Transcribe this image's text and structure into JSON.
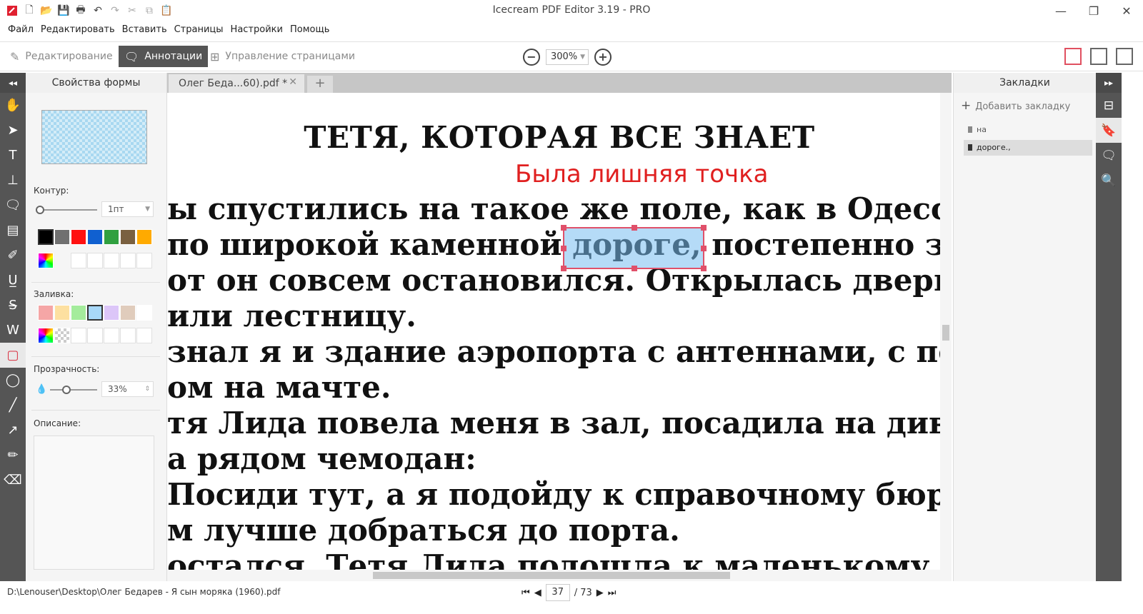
{
  "window": {
    "title": "Icecream PDF Editor 3.19 - PRO",
    "controls": {
      "minimize": "—",
      "maximize": "❐",
      "close": "✕"
    }
  },
  "menu": [
    "Файл",
    "Редактировать",
    "Вставить",
    "Страницы",
    "Настройки",
    "Помощь"
  ],
  "modes": {
    "edit": "Редактирование",
    "annotations": "Аннотации",
    "page_management": "Управление страницами",
    "active": "annotations"
  },
  "zoom": {
    "value": "300%",
    "minus": "−",
    "plus": "+"
  },
  "properties": {
    "header": "Свойства формы",
    "outline_label": "Контур:",
    "outline_width": "1пт",
    "fill_label": "Заливка:",
    "opacity_label": "Прозрачность:",
    "opacity_value": "33%",
    "description_label": "Описание:",
    "outline_colors": [
      "#000000",
      "#707070",
      "#ff1010",
      "#1060d0",
      "#30a040",
      "#7a6040",
      "#ffaa00"
    ],
    "fill_colors": [
      "#f5a6a6",
      "#fde0a0",
      "#a4ec9c",
      "#a8d8f8",
      "#dcc6f8",
      "#e0ccbc",
      "#ffffff"
    ],
    "selected_fill": "#a8d8f8"
  },
  "document": {
    "tab_label": "Олег Беда...60).pdf *",
    "title": "ТЕТЯ, КОТОРАЯ ВСЕ ЗНАЕТ",
    "annotation_text": "Была лишняя точка",
    "lines": [
      "ы спустились на такое же поле, как в Одессе. С",
      "по широкой каменной дороге, постепенно за",
      "от он совсем остановился. Открылась дверь, м",
      "или лестницу.",
      "знал я и здание аэропорта с антеннами, с пол",
      "ом на мачте.",
      "тя Лида повела меня в зал, посадила на див",
      "а рядом чемодан:",
      "Посиди тут, а я подойду к справочному бюро",
      "м лучше добраться до порта.",
      "остался. Тетя Лида подошла к маленькому о"
    ]
  },
  "bookmarks": {
    "header": "Закладки",
    "add_label": "Добавить закладку",
    "items": [
      "на",
      "дороге.,"
    ]
  },
  "status": {
    "path": "D:\\Lenouser\\Desktop\\Олег Бедарев - Я сын моряка (1960).pdf",
    "page_current": "37",
    "page_total": "/ 73"
  }
}
